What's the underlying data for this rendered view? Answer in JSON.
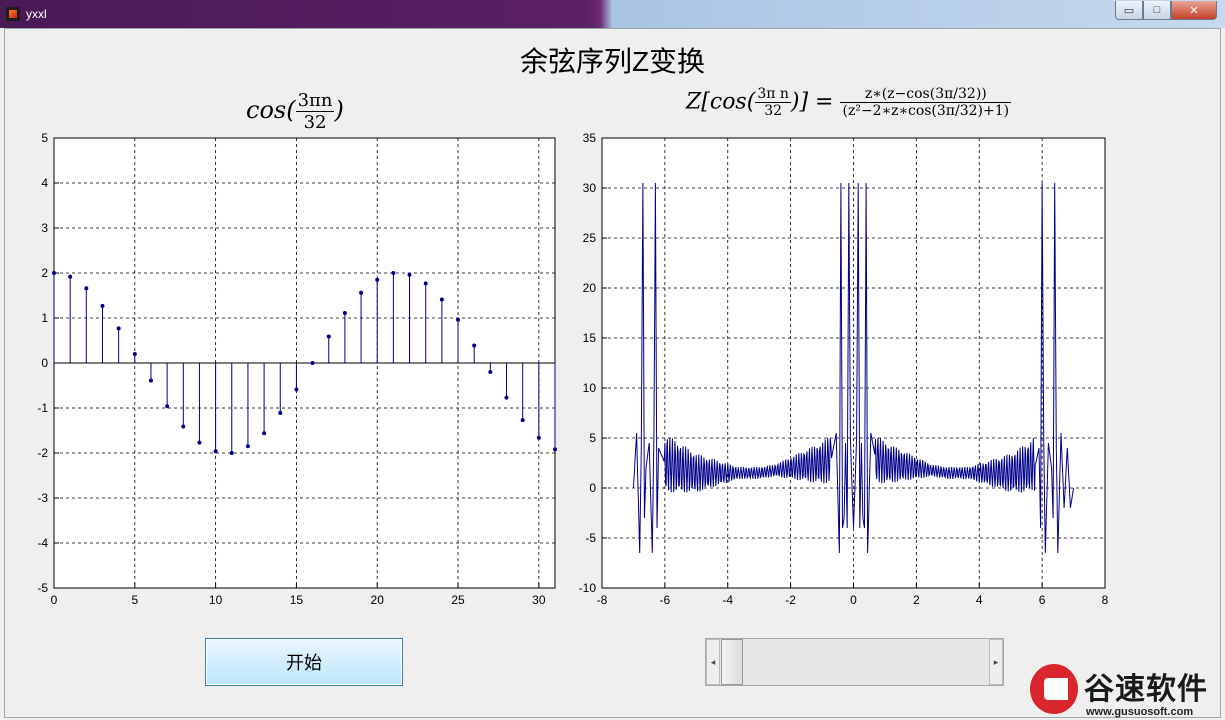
{
  "window": {
    "title": "yxxl",
    "min": "▭",
    "max": "□",
    "close": "✕"
  },
  "main_title": "余弦序列Z变换",
  "left_plot": {
    "title_func": "cos(",
    "title_num": "3πn",
    "title_den": "32",
    "title_close": ")"
  },
  "right_plot": {
    "title_lhs": "Z[cos(",
    "title_lhs_num": "3π n",
    "title_lhs_den": "32",
    "title_lhs_close": ")] =",
    "title_rhs_num": "z∗(z−cos(3π/32))",
    "title_rhs_den": "(z²−2∗z∗cos(3π/32)+1)"
  },
  "start_button": "开始",
  "slider": {
    "left_arrow": "◂",
    "right_arrow": "▸"
  },
  "watermark": {
    "brand": "谷速软件",
    "url": "www.gusuosoft.com"
  },
  "chart_data": [
    {
      "type": "stem",
      "xlim": [
        0,
        31
      ],
      "ylim": [
        -5,
        5
      ],
      "xticks": [
        0,
        5,
        10,
        15,
        20,
        25,
        30
      ],
      "yticks": [
        -5,
        -4,
        -3,
        -2,
        -1,
        0,
        1,
        2,
        3,
        4,
        5
      ],
      "grid": true,
      "series": [
        {
          "color": "#00008b",
          "x": [
            0,
            1,
            2,
            3,
            4,
            5,
            6,
            7,
            8,
            9,
            10,
            11,
            12,
            13,
            14,
            15,
            16,
            17,
            18,
            19,
            20,
            21,
            22,
            23,
            24,
            25,
            26,
            27,
            28,
            29,
            30,
            31
          ],
          "values": [
            2,
            1.92,
            1.66,
            1.27,
            0.77,
            0.2,
            -0.39,
            -0.96,
            -1.41,
            -1.77,
            -1.96,
            -2,
            -1.85,
            -1.56,
            -1.11,
            -0.59,
            0,
            0.59,
            1.11,
            1.56,
            1.85,
            2,
            1.96,
            1.77,
            1.41,
            0.96,
            0.39,
            -0.2,
            -0.77,
            -1.27,
            -1.66,
            -1.92
          ]
        }
      ]
    },
    {
      "type": "line",
      "xlim": [
        -8,
        8
      ],
      "ylim": [
        -10,
        35
      ],
      "xticks": [
        -8,
        -6,
        -4,
        -2,
        0,
        2,
        4,
        6,
        8
      ],
      "yticks": [
        -10,
        -5,
        0,
        5,
        10,
        15,
        20,
        25,
        30,
        35
      ],
      "grid": true,
      "series": [
        {
          "color": "#00008b",
          "x": [
            -7,
            -6.9,
            -6.8,
            -6.75,
            -6.7,
            -6.65,
            -6.6,
            -6.5,
            -6.4,
            -6.35,
            -6.3,
            -6.25,
            -6.2,
            -6,
            -5.5,
            -5,
            -4,
            -3,
            -2,
            -1,
            -0.7,
            -0.55,
            -0.45,
            -0.4,
            -0.35,
            -0.3,
            -0.25,
            -0.2,
            -0.15,
            -0.1,
            0,
            0.1,
            0.15,
            0.2,
            0.25,
            0.3,
            0.35,
            0.4,
            0.45,
            0.55,
            0.7,
            1,
            2,
            3,
            4,
            5,
            5.5,
            5.8,
            5.9,
            5.95,
            6,
            6.05,
            6.1,
            6.2,
            6.3,
            6.35,
            6.4,
            6.45,
            6.5,
            6.6,
            6.7,
            6.8,
            6.9,
            7
          ],
          "values": [
            0,
            5.5,
            -6.5,
            4,
            30.5,
            -3,
            2,
            4.5,
            -6.5,
            5,
            30.5,
            -4,
            4,
            2.5,
            2,
            1.5,
            1.5,
            1.5,
            2,
            2.5,
            3,
            5.5,
            -6.5,
            30.5,
            -4,
            -3,
            4.5,
            -4,
            30.5,
            5,
            -4,
            5,
            30.5,
            -4,
            4.5,
            -3,
            -4,
            30.5,
            -6.5,
            5.5,
            3,
            2.5,
            2,
            1.5,
            1.5,
            1.5,
            2,
            2.5,
            4,
            -4,
            30.5,
            5,
            -6.5,
            4.5,
            2,
            -3,
            30.5,
            4,
            -6.5,
            5.5,
            -2,
            4,
            -2,
            0
          ]
        }
      ]
    }
  ]
}
